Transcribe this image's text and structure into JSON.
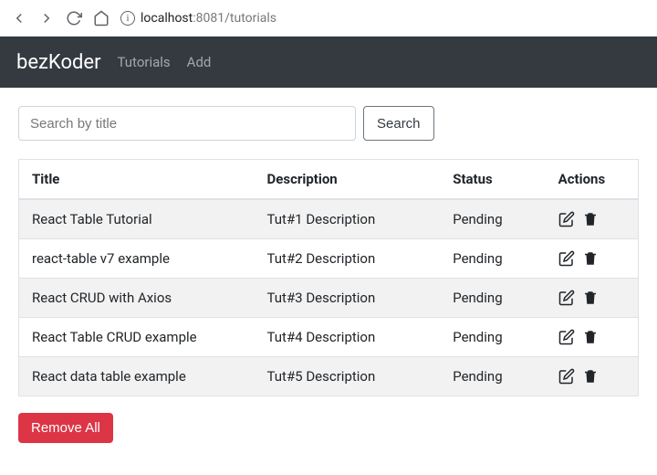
{
  "browser": {
    "url_host": "localhost",
    "url_port_path": ":8081/tutorials"
  },
  "nav": {
    "brand": "bezKoder",
    "link_tutorials": "Tutorials",
    "link_add": "Add"
  },
  "search": {
    "placeholder": "Search by title",
    "button": "Search"
  },
  "table": {
    "headers": {
      "title": "Title",
      "description": "Description",
      "status": "Status",
      "actions": "Actions"
    },
    "rows": [
      {
        "title": "React Table Tutorial",
        "description": "Tut#1 Description",
        "status": "Pending"
      },
      {
        "title": "react-table v7 example",
        "description": "Tut#2 Description",
        "status": "Pending"
      },
      {
        "title": "React CRUD with Axios",
        "description": "Tut#3 Description",
        "status": "Pending"
      },
      {
        "title": "React Table CRUD example",
        "description": "Tut#4 Description",
        "status": "Pending"
      },
      {
        "title": "React data table example",
        "description": "Tut#5 Description",
        "status": "Pending"
      }
    ]
  },
  "buttons": {
    "remove_all": "Remove All"
  }
}
